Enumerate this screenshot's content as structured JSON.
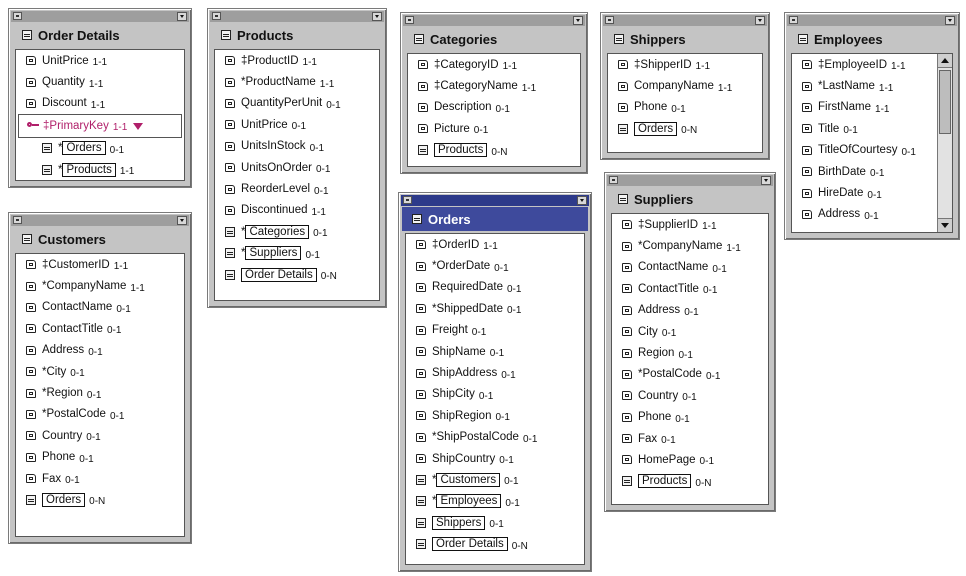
{
  "windows": {
    "order_details": {
      "title": "Order Details",
      "rows": [
        {
          "label": "UnitPrice",
          "card": "1-1"
        },
        {
          "label": "Quantity",
          "card": "1-1"
        },
        {
          "label": "Discount",
          "card": "1-1"
        }
      ],
      "pk": {
        "label": "‡PrimaryKey",
        "card": "1-1"
      },
      "sub": [
        {
          "prefix": "*",
          "ref": "Orders",
          "card": "0-1"
        },
        {
          "prefix": "*",
          "ref": "Products",
          "card": "1-1"
        }
      ]
    },
    "products": {
      "title": "Products",
      "rows": [
        {
          "label": "‡ProductID",
          "card": "1-1"
        },
        {
          "label": "*ProductName",
          "card": "1-1"
        },
        {
          "label": "QuantityPerUnit",
          "card": "0-1"
        },
        {
          "label": "UnitPrice",
          "card": "0-1"
        },
        {
          "label": "UnitsInStock",
          "card": "0-1"
        },
        {
          "label": "UnitsOnOrder",
          "card": "0-1"
        },
        {
          "label": "ReorderLevel",
          "card": "0-1"
        },
        {
          "label": "Discontinued",
          "card": "1-1"
        }
      ],
      "refs": [
        {
          "prefix": "*",
          "ref": "Categories",
          "card": "0-1"
        },
        {
          "prefix": "*",
          "ref": "Suppliers",
          "card": "0-1"
        },
        {
          "prefix": "",
          "ref": "Order Details",
          "card": "0-N"
        }
      ]
    },
    "categories": {
      "title": "Categories",
      "rows": [
        {
          "label": "‡CategoryID",
          "card": "1-1"
        },
        {
          "label": "‡CategoryName",
          "card": "1-1"
        },
        {
          "label": "Description",
          "card": "0-1"
        },
        {
          "label": "Picture",
          "card": "0-1"
        }
      ],
      "refs": [
        {
          "prefix": "",
          "ref": "Products",
          "card": "0-N"
        }
      ]
    },
    "shippers": {
      "title": "Shippers",
      "rows": [
        {
          "label": "‡ShipperID",
          "card": "1-1"
        },
        {
          "label": "CompanyName",
          "card": "1-1"
        },
        {
          "label": "Phone",
          "card": "0-1"
        }
      ],
      "refs": [
        {
          "prefix": "",
          "ref": "Orders",
          "card": "0-N"
        }
      ]
    },
    "employees": {
      "title": "Employees",
      "rows": [
        {
          "label": "‡EmployeeID",
          "card": "1-1"
        },
        {
          "label": "*LastName",
          "card": "1-1"
        },
        {
          "label": "FirstName",
          "card": "1-1"
        },
        {
          "label": "Title",
          "card": "0-1"
        },
        {
          "label": "TitleOfCourtesy",
          "card": "0-1"
        },
        {
          "label": "BirthDate",
          "card": "0-1"
        },
        {
          "label": "HireDate",
          "card": "0-1"
        },
        {
          "label": "Address",
          "card": "0-1"
        }
      ]
    },
    "customers": {
      "title": "Customers",
      "rows": [
        {
          "label": "‡CustomerID",
          "card": "1-1"
        },
        {
          "label": "*CompanyName",
          "card": "1-1"
        },
        {
          "label": "ContactName",
          "card": "0-1"
        },
        {
          "label": "ContactTitle",
          "card": "0-1"
        },
        {
          "label": "Address",
          "card": "0-1"
        },
        {
          "label": "*City",
          "card": "0-1"
        },
        {
          "label": "*Region",
          "card": "0-1"
        },
        {
          "label": "*PostalCode",
          "card": "0-1"
        },
        {
          "label": "Country",
          "card": "0-1"
        },
        {
          "label": "Phone",
          "card": "0-1"
        },
        {
          "label": "Fax",
          "card": "0-1"
        }
      ],
      "refs": [
        {
          "prefix": "",
          "ref": "Orders",
          "card": "0-N"
        }
      ]
    },
    "orders": {
      "title": "Orders",
      "rows": [
        {
          "label": "‡OrderID",
          "card": "1-1"
        },
        {
          "label": "*OrderDate",
          "card": "0-1"
        },
        {
          "label": "RequiredDate",
          "card": "0-1"
        },
        {
          "label": "*ShippedDate",
          "card": "0-1"
        },
        {
          "label": "Freight",
          "card": "0-1"
        },
        {
          "label": "ShipName",
          "card": "0-1"
        },
        {
          "label": "ShipAddress",
          "card": "0-1"
        },
        {
          "label": "ShipCity",
          "card": "0-1"
        },
        {
          "label": "ShipRegion",
          "card": "0-1"
        },
        {
          "label": "*ShipPostalCode",
          "card": "0-1"
        },
        {
          "label": "ShipCountry",
          "card": "0-1"
        }
      ],
      "refs": [
        {
          "prefix": "*",
          "ref": "Customers",
          "card": "0-1"
        },
        {
          "prefix": "*",
          "ref": "Employees",
          "card": "0-1"
        },
        {
          "prefix": "",
          "ref": "Shippers",
          "card": "0-1"
        },
        {
          "prefix": "",
          "ref": "Order Details",
          "card": "0-N"
        }
      ]
    },
    "suppliers": {
      "title": "Suppliers",
      "rows": [
        {
          "label": "‡SupplierID",
          "card": "1-1"
        },
        {
          "label": "*CompanyName",
          "card": "1-1"
        },
        {
          "label": "ContactName",
          "card": "0-1"
        },
        {
          "label": "ContactTitle",
          "card": "0-1"
        },
        {
          "label": "Address",
          "card": "0-1"
        },
        {
          "label": "City",
          "card": "0-1"
        },
        {
          "label": "Region",
          "card": "0-1"
        },
        {
          "label": "*PostalCode",
          "card": "0-1"
        },
        {
          "label": "Country",
          "card": "0-1"
        },
        {
          "label": "Phone",
          "card": "0-1"
        },
        {
          "label": "Fax",
          "card": "0-1"
        },
        {
          "label": "HomePage",
          "card": "0-1"
        }
      ],
      "refs": [
        {
          "prefix": "",
          "ref": "Products",
          "card": "0-N"
        }
      ]
    }
  }
}
